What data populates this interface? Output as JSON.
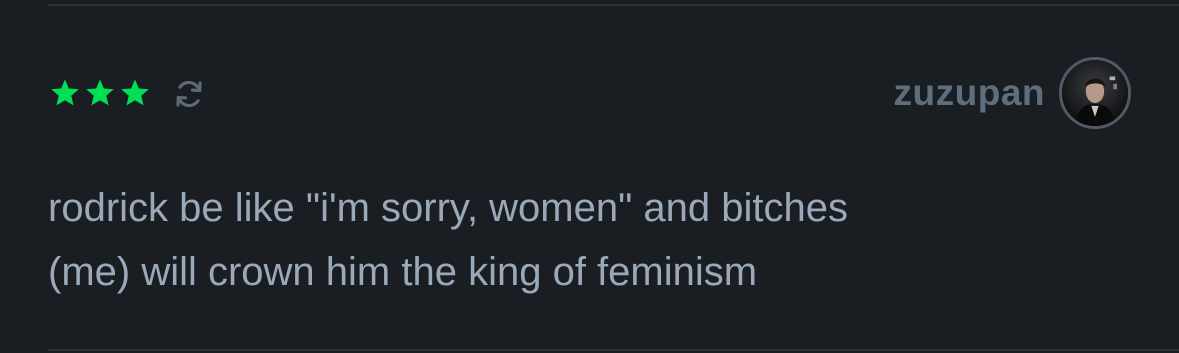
{
  "review": {
    "rating": {
      "value": 3,
      "max": 5,
      "star_color": "#00e054"
    },
    "rewatch_icon": "rewatch-icon",
    "user": {
      "username": "zuzupan",
      "avatar_icon": "avatar"
    },
    "text": {
      "line1": "rodrick be like \"i'm sorry, women\" and bitches",
      "line2": "(me) will crown him the king of feminism"
    }
  },
  "colors": {
    "background": "#1a1d22",
    "username": "#5f6e7e",
    "body_text": "#9aa9b9",
    "icon_muted": "#5d6a78",
    "divider": "#2d333c"
  }
}
